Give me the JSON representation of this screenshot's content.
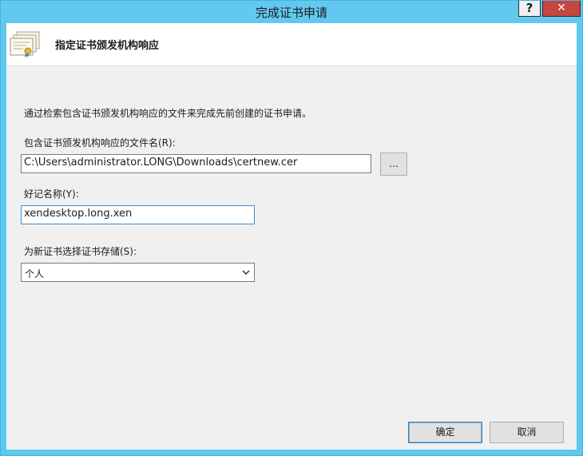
{
  "window": {
    "title": "完成证书申请",
    "help_label": "?",
    "close_label": "✕"
  },
  "header": {
    "title": "指定证书颁发机构响应",
    "icon": "certificate-icon"
  },
  "form": {
    "intro": "通过检索包含证书颁发机构响应的文件来完成先前创建的证书申请。",
    "file_label": "包含证书颁发机构响应的文件名(R):",
    "file_value": "C:\\Users\\administrator.LONG\\Downloads\\certnew.cer",
    "browse_label": "...",
    "friendly_label": "好记名称(Y):",
    "friendly_value": "xendesktop.long.xen",
    "store_label": "为新证书选择证书存储(S):",
    "store_value": "个人"
  },
  "footer": {
    "ok_label": "确定",
    "cancel_label": "取消"
  },
  "colors": {
    "titlebar": "#62c8ef",
    "close": "#c7463d",
    "client": "#f0f0f0"
  }
}
